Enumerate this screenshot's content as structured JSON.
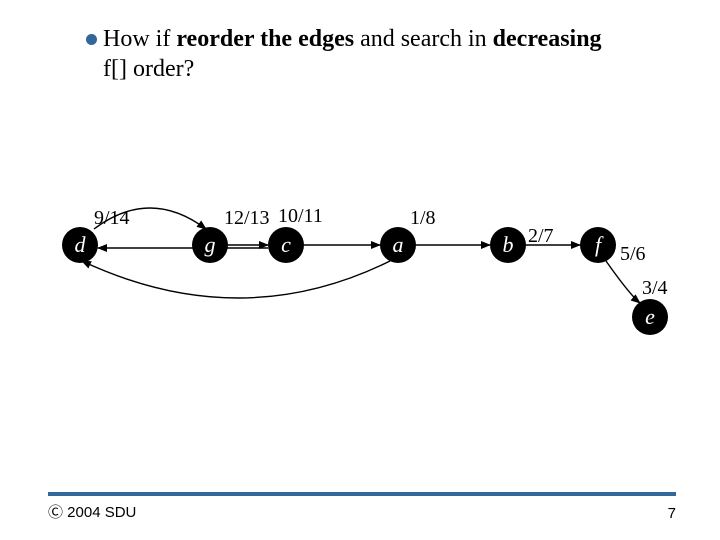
{
  "question": {
    "prefix": "How if ",
    "bold1": "reorder the edges",
    "mid": " and search in ",
    "bold2": "decreasing",
    "suffix": " f[] order?"
  },
  "nodes": {
    "d": {
      "label": "d",
      "time": "9/14"
    },
    "g": {
      "label": "g",
      "time": "12/13"
    },
    "c": {
      "label": "c",
      "time": "10/11"
    },
    "a": {
      "label": "a",
      "time": "1/8"
    },
    "b": {
      "label": "b",
      "time": "2/7"
    },
    "f": {
      "label": "f",
      "time": "5/6"
    },
    "e": {
      "label": "e",
      "time": "3/4"
    }
  },
  "footer": {
    "copyright": "Ⓒ 2004 SDU",
    "page": "7"
  },
  "chart_data": {
    "type": "graph",
    "title": "DFS graph with discovery/finish times",
    "nodes": [
      {
        "id": "d",
        "time": "9/14"
      },
      {
        "id": "g",
        "time": "12/13"
      },
      {
        "id": "c",
        "time": "10/11"
      },
      {
        "id": "a",
        "time": "1/8"
      },
      {
        "id": "b",
        "time": "2/7"
      },
      {
        "id": "f",
        "time": "5/6"
      },
      {
        "id": "e",
        "time": "3/4"
      }
    ],
    "edges": [
      {
        "from": "d",
        "to": "g"
      },
      {
        "from": "g",
        "to": "c"
      },
      {
        "from": "c",
        "to": "d"
      },
      {
        "from": "c",
        "to": "a"
      },
      {
        "from": "a",
        "to": "b"
      },
      {
        "from": "b",
        "to": "f"
      },
      {
        "from": "f",
        "to": "e"
      },
      {
        "from": "a",
        "to": "d",
        "curved": true
      }
    ]
  }
}
